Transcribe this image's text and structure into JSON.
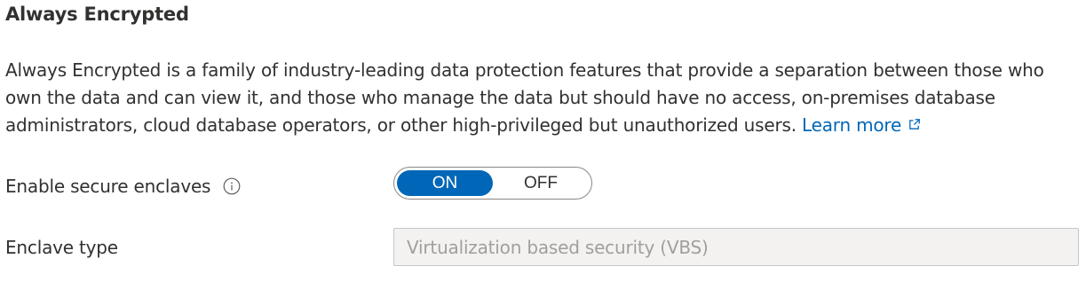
{
  "section": {
    "title": "Always Encrypted",
    "description": "Always Encrypted is a family of industry-leading data protection features that provide a separation between those who own the data and can view it, and those who manage the data but should have no access, on-premises database administrators, cloud database operators, or other high-privileged but unauthorized users.",
    "learn_more": "Learn more",
    "learn_more_icon": "external-link-icon"
  },
  "secure_enclaves": {
    "label": "Enable secure enclaves",
    "info_icon": "info-icon",
    "on_label": "ON",
    "off_label": "OFF",
    "selected": "ON"
  },
  "enclave_type": {
    "label": "Enclave type",
    "value": "Virtualization based security (VBS)",
    "disabled": true
  },
  "colors": {
    "accent": "#0067b8",
    "text": "#323130",
    "disabled_text": "#a19f9d",
    "disabled_bg": "#f3f2f1"
  }
}
